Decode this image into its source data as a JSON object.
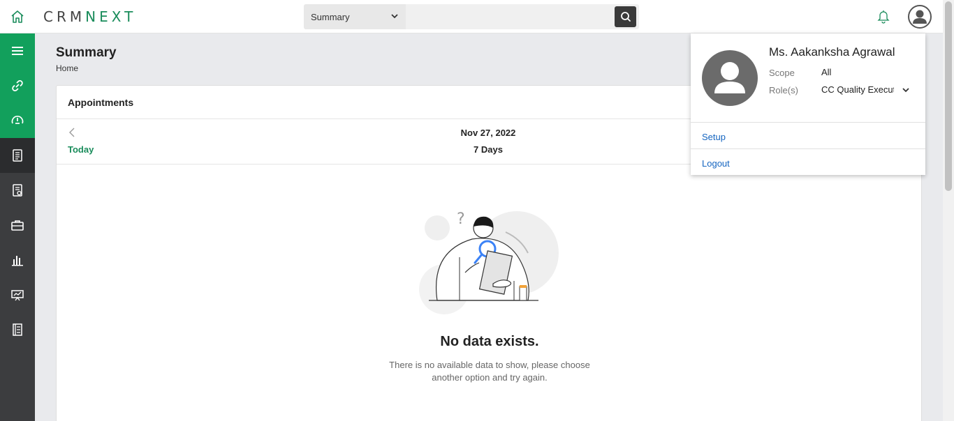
{
  "header": {
    "logo_prefix": "CRM",
    "logo_suffix": "NEXT",
    "search": {
      "selected_module": "Summary",
      "placeholder": "",
      "value": ""
    }
  },
  "sidebar": {
    "items": [
      {
        "icon": "menu-icon"
      },
      {
        "icon": "link-icon"
      },
      {
        "icon": "dashboard-clock-icon"
      },
      {
        "icon": "document-icon"
      },
      {
        "icon": "report-icon"
      },
      {
        "icon": "briefcase-icon"
      },
      {
        "icon": "bar-chart-icon"
      },
      {
        "icon": "presentation-icon"
      },
      {
        "icon": "ledger-icon"
      }
    ]
  },
  "page": {
    "title": "Summary",
    "breadcrumb": "Home"
  },
  "appointments": {
    "title": "Appointments",
    "today_label": "Today",
    "date": "Nov 27, 2022",
    "range": "7 Days",
    "empty_title": "No data exists.",
    "empty_desc": "There is no available data to show, please choose another option and try again."
  },
  "profile": {
    "name": "Ms. Aakanksha Agrawal",
    "scope_label": "Scope",
    "scope_value": "All",
    "roles_label": "Role(s)",
    "roles_value": "CC Quality Execut",
    "setup": "Setup",
    "logout": "Logout"
  },
  "colors": {
    "brand_green": "#12a05c",
    "sidebar_dark": "#3c3d3f",
    "link_blue": "#1565c0"
  }
}
